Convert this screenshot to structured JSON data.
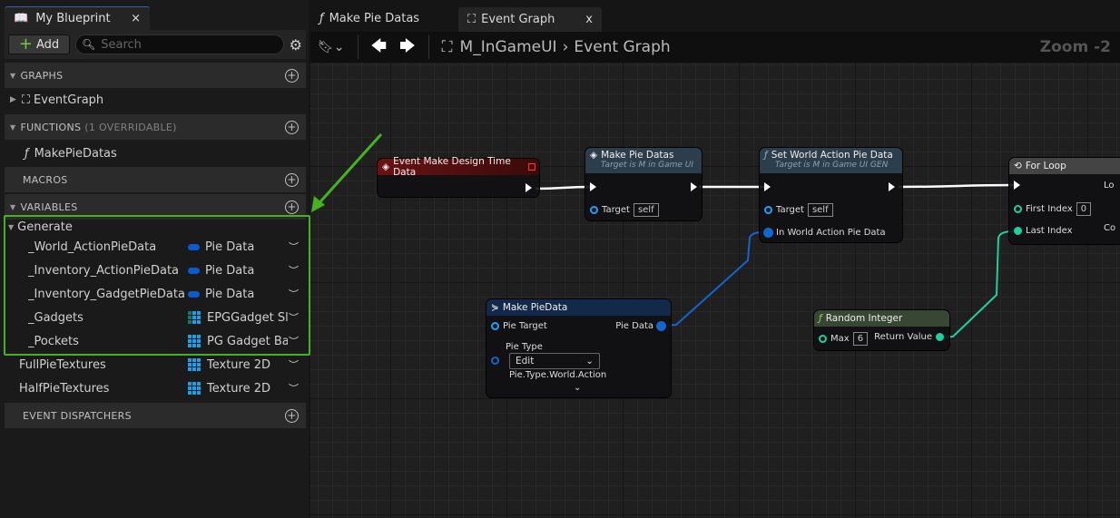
{
  "left_panel": {
    "tab_title": "My Blueprint",
    "tab_close": "×",
    "add_label": "Add",
    "search_placeholder": "Search",
    "sections": {
      "graphs": "GRAPHS",
      "functions": "FUNCTIONS",
      "functions_sub": "(1 OVERRIDABLE)",
      "macros": "MACROS",
      "variables": "VARIABLES",
      "event_dispatchers": "EVENT DISPATCHERS"
    },
    "graph_item": "EventGraph",
    "function_item": "MakePieDatas",
    "variable_category": "Generate",
    "variables": [
      {
        "name": "_World_ActionPieData",
        "type": "Pie Data",
        "icon": "struct-pill"
      },
      {
        "name": "_Inventory_ActionPieData",
        "type": "Pie Data",
        "icon": "struct-pill"
      },
      {
        "name": "_Inventory_GadgetPieData",
        "type": "Pie Data",
        "icon": "struct-pill"
      },
      {
        "name": "_Gadgets",
        "type": "EPGGadget Slot",
        "icon": "array-list"
      },
      {
        "name": "_Pockets",
        "type": "PG Gadget Base",
        "icon": "map-grid"
      },
      {
        "name": "FullPieTextures",
        "type": "Texture 2D",
        "icon": "map-grid"
      },
      {
        "name": "HalfPieTextures",
        "type": "Texture 2D",
        "icon": "map-grid"
      }
    ]
  },
  "tabs": [
    {
      "label": "Make Pie Datas",
      "icon": "function-icon"
    },
    {
      "label": "Event Graph",
      "icon": "graph-icon",
      "close": "x"
    }
  ],
  "toolbar": {
    "breadcrumb_root": "M_InGameUI",
    "breadcrumb_sep": "›",
    "breadcrumb_current": "Event Graph",
    "zoom": "Zoom -2"
  },
  "nodes": {
    "event": {
      "title": "Event Make Design Time Data"
    },
    "make_pie_datas": {
      "title": "Make Pie Datas",
      "subtitle": "Target is M in Game UI",
      "target": "Target",
      "self": "self"
    },
    "set_world": {
      "title": "Set World Action Pie Data",
      "subtitle": "Target is M in Game UI GEN",
      "target": "Target",
      "self": "self",
      "input": "In World Action Pie Data"
    },
    "for_loop": {
      "title": "For Loop",
      "first_index": "First Index",
      "first_value": "0",
      "last_index": "Last Index",
      "out1": "Lo",
      "out2": "Co"
    },
    "make_piedata": {
      "title": "Make PieData",
      "pie_target": "Pie Target",
      "pie_data": "Pie Data",
      "pie_type": "Pie Type",
      "dropdown": "Edit",
      "type_value": "Pie.Type.World.Action",
      "expand": "⌄"
    },
    "random_integer": {
      "title": "Random Integer",
      "max": "Max",
      "max_value": "6",
      "return": "Return Value"
    }
  },
  "colors": {
    "highlight": "#45b21f",
    "event_header": "#6a1212",
    "function_header": "#2c3e4c",
    "struct_header": "#13294a",
    "pure_header": "#384733",
    "struct_pin": "#1565d0",
    "int_pin": "#1ed0a0"
  }
}
